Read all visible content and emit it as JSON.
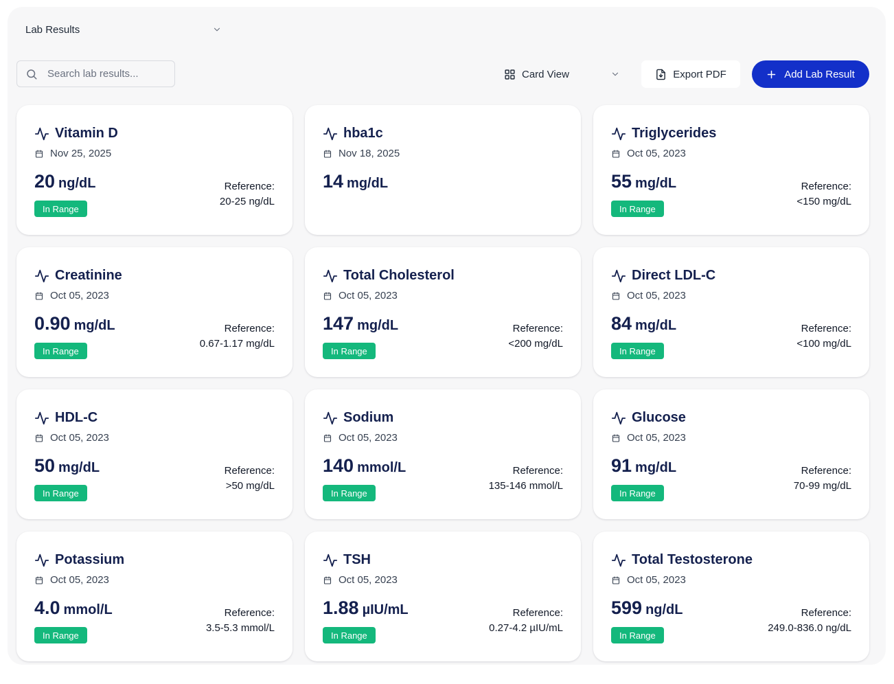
{
  "header": {
    "section_select": "Lab Results",
    "search_placeholder": "Search lab results...",
    "view_select": "Card View",
    "export_label": "Export PDF",
    "add_label": "Add Lab Result"
  },
  "colors": {
    "accent": "#1330c9",
    "title": "#14204e",
    "badge": "#14b87c",
    "background": "#f7f7f8"
  },
  "icons": {
    "card_title": "activity-icon",
    "card_date": "calendar-icon",
    "view": "grid-icon",
    "export": "file-download-icon",
    "add": "plus-icon",
    "search": "search-icon",
    "select": "chevron-down-icon"
  },
  "reference_label": "Reference:",
  "cards": [
    {
      "name": "Vitamin D",
      "date": "Nov 25, 2025",
      "value": "20",
      "unit": "ng/dL",
      "status": "In Range",
      "reference_label": "Reference:",
      "reference": "20-25 ng/dL"
    },
    {
      "name": "hba1c",
      "date": "Nov 18, 2025",
      "value": "14",
      "unit": "mg/dL",
      "status": "",
      "reference_label": "",
      "reference": ""
    },
    {
      "name": "Triglycerides",
      "date": "Oct 05, 2023",
      "value": "55",
      "unit": "mg/dL",
      "status": "In Range",
      "reference_label": "Reference:",
      "reference": "<150 mg/dL"
    },
    {
      "name": "Creatinine",
      "date": "Oct 05, 2023",
      "value": "0.90",
      "unit": "mg/dL",
      "status": "In Range",
      "reference_label": "Reference:",
      "reference": "0.67-1.17 mg/dL"
    },
    {
      "name": "Total Cholesterol",
      "date": "Oct 05, 2023",
      "value": "147",
      "unit": "mg/dL",
      "status": "In Range",
      "reference_label": "Reference:",
      "reference": "<200 mg/dL"
    },
    {
      "name": "Direct LDL-C",
      "date": "Oct 05, 2023",
      "value": "84",
      "unit": "mg/dL",
      "status": "In Range",
      "reference_label": "Reference:",
      "reference": "<100 mg/dL"
    },
    {
      "name": "HDL-C",
      "date": "Oct 05, 2023",
      "value": "50",
      "unit": "mg/dL",
      "status": "In Range",
      "reference_label": "Reference:",
      "reference": ">50 mg/dL"
    },
    {
      "name": "Sodium",
      "date": "Oct 05, 2023",
      "value": "140",
      "unit": "mmol/L",
      "status": "In Range",
      "reference_label": "Reference:",
      "reference": "135-146 mmol/L"
    },
    {
      "name": "Glucose",
      "date": "Oct 05, 2023",
      "value": "91",
      "unit": "mg/dL",
      "status": "In Range",
      "reference_label": "Reference:",
      "reference": "70-99 mg/dL"
    },
    {
      "name": "Potassium",
      "date": "Oct 05, 2023",
      "value": "4.0",
      "unit": "mmol/L",
      "status": "In Range",
      "reference_label": "Reference:",
      "reference": "3.5-5.3 mmol/L"
    },
    {
      "name": "TSH",
      "date": "Oct 05, 2023",
      "value": "1.88",
      "unit": "µIU/mL",
      "status": "In Range",
      "reference_label": "Reference:",
      "reference": "0.27-4.2 µIU/mL"
    },
    {
      "name": "Total Testosterone",
      "date": "Oct 05, 2023",
      "value": "599",
      "unit": "ng/dL",
      "status": "In Range",
      "reference_label": "Reference:",
      "reference": "249.0-836.0 ng/dL"
    }
  ]
}
